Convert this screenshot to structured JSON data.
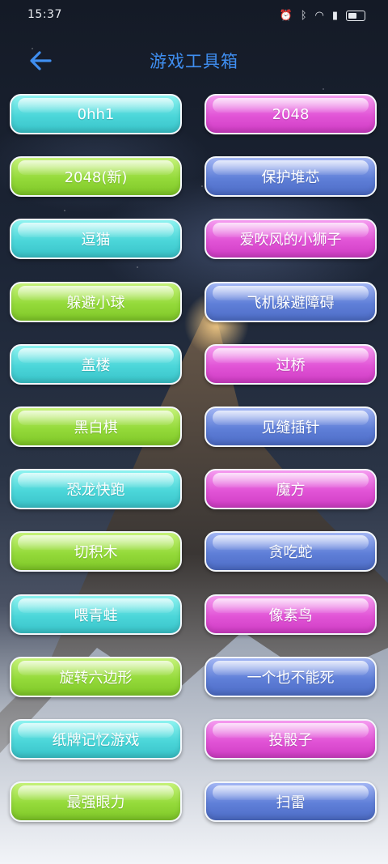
{
  "status_bar": {
    "time": "15:37",
    "icons": [
      "alarm-icon",
      "bluetooth-icon",
      "wifi-icon",
      "signal-icon",
      "battery-icon"
    ]
  },
  "header": {
    "back_icon": "arrow-left-icon",
    "title": "游戏工具箱"
  },
  "theme": {
    "title_color": "#3f8ef0",
    "button_colors": {
      "cyan": "#4bd6d9",
      "magenta": "#e154d6",
      "green": "#94da3a",
      "blue": "#5f7fd8"
    }
  },
  "games": [
    {
      "label": "0hh1",
      "color": "cyan"
    },
    {
      "label": "2048",
      "color": "magenta"
    },
    {
      "label": "2048(新)",
      "color": "green"
    },
    {
      "label": "保护堆芯",
      "color": "blue"
    },
    {
      "label": "逗猫",
      "color": "cyan"
    },
    {
      "label": "爱吹风的小狮子",
      "color": "magenta"
    },
    {
      "label": "躲避小球",
      "color": "green"
    },
    {
      "label": "飞机躲避障碍",
      "color": "blue"
    },
    {
      "label": "盖楼",
      "color": "cyan"
    },
    {
      "label": "过桥",
      "color": "magenta"
    },
    {
      "label": "黑白棋",
      "color": "green"
    },
    {
      "label": "见缝插针",
      "color": "blue"
    },
    {
      "label": "恐龙快跑",
      "color": "cyan"
    },
    {
      "label": "魔方",
      "color": "magenta"
    },
    {
      "label": "切积木",
      "color": "green"
    },
    {
      "label": "贪吃蛇",
      "color": "blue"
    },
    {
      "label": "喂青蛙",
      "color": "cyan"
    },
    {
      "label": "像素鸟",
      "color": "magenta"
    },
    {
      "label": "旋转六边形",
      "color": "green"
    },
    {
      "label": "一个也不能死",
      "color": "blue"
    },
    {
      "label": "纸牌记忆游戏",
      "color": "cyan"
    },
    {
      "label": "投骰子",
      "color": "magenta"
    },
    {
      "label": "最强眼力",
      "color": "green"
    },
    {
      "label": "扫雷",
      "color": "blue"
    }
  ]
}
